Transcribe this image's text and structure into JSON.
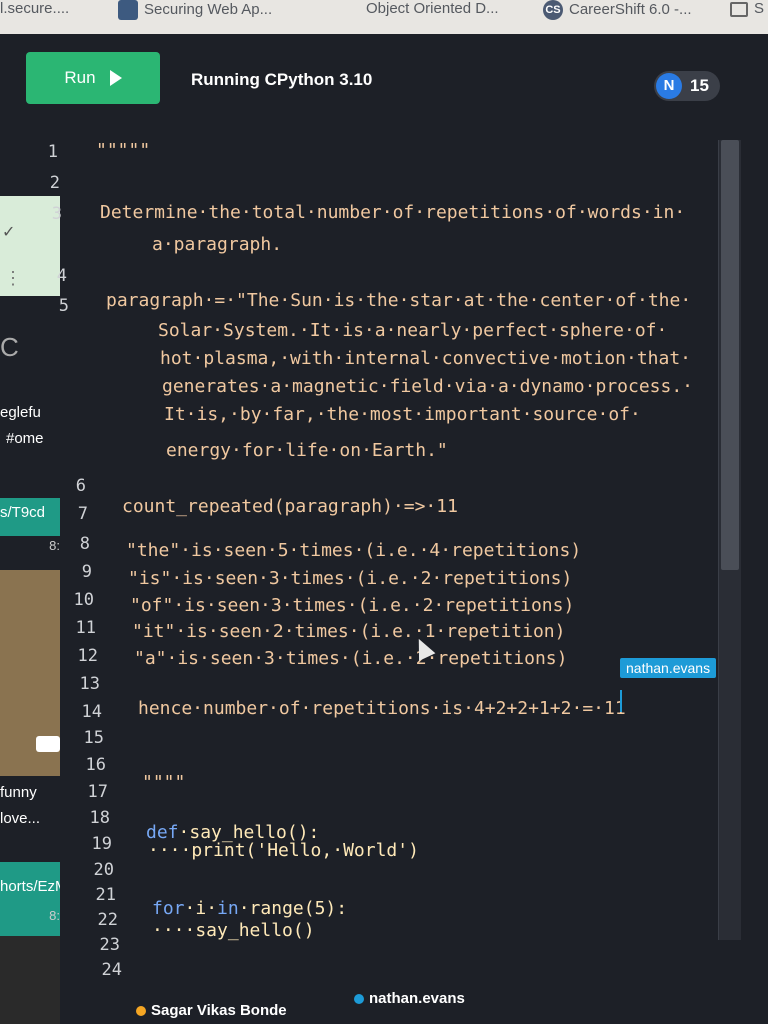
{
  "bookmarks": [
    {
      "label": "l.secure....",
      "icon": "lock-icon"
    },
    {
      "label": "Securing Web Ap...",
      "icon": "site-icon"
    },
    {
      "label": "Object Oriented D...",
      "icon": ""
    },
    {
      "label": "CareerShift 6.0 -...",
      "icon": "cs-icon"
    },
    {
      "label": "S",
      "icon": "folder-icon"
    }
  ],
  "left_panel": {
    "egleft": "eglefu",
    "home": "#ome",
    "path": "s/T9cd",
    "n8": "8:",
    "funny": "funny",
    "love": "love...",
    "shorts": "horts/EzMr",
    "n8b": "8:",
    "c": "C",
    "chevron": "✓"
  },
  "toolbar": {
    "run_label": "Run",
    "runtime_status": "Running CPython 3.10",
    "user_initial": "N",
    "user_count": "15"
  },
  "editor": {
    "line_numbers": [
      "1",
      "2",
      "3",
      "4",
      "5",
      "6",
      "7",
      "8",
      "9",
      "10",
      "11",
      "12",
      "13",
      "14",
      "15",
      "16",
      "17",
      "18",
      "19",
      "20",
      "21",
      "22",
      "23",
      "24"
    ],
    "lines": {
      "l1": "\"\"\"\"\"",
      "l3a": "Determine·the·total·number·of·repetitions·of·words·in·",
      "l3b": "a·paragraph.",
      "l5a": "paragraph·=·\"The·Sun·is·the·star·at·the·center·of·the·",
      "l5b": "Solar·System.·It·is·a·nearly·perfect·sphere·of·",
      "l5c": "hot·plasma,·with·internal·convective·motion·that·",
      "l5d": "generates·a·magnetic·field·via·a·dynamo·process.·",
      "l5e": "It·is,·by·far,·the·most·important·source·of·",
      "l5f": "energy·for·life·on·Earth.\"",
      "l7": "count_repeated(paragraph)·=>·11",
      "l9": "\"the\"·is·seen·5·times·(i.e.·4·repetitions)",
      "l10": "\"is\"·is·seen·3·times·(i.e.·2·repetitions)",
      "l11": "\"of\"·is·seen·3·times·(i.e.·2·repetitions)",
      "l12": "\"it\"·is·seen·2·times·(i.e.·1·repetition)",
      "l13": "\"a\"·is·seen·3·times·(i.e.·2·repetitions)",
      "l15": "hence·number·of·repetitions·is·4+2+2+1+2·=·11",
      "l17": "\"\"\"\"",
      "l19_kw": "def",
      "l19_rest": "·say_hello():",
      "l20": "····print('Hello,·World')",
      "l22_for": "for",
      "l22_i": "·i·",
      "l22_in": "in",
      "l22_rest": "·range(5):",
      "l23": "····say_hello()"
    },
    "cursor_user": "nathan.evans"
  },
  "footer": {
    "collaborators": [
      {
        "name": "Sagar Vikas Bonde",
        "color": "#f5a623"
      },
      {
        "name": "nathan.evans",
        "color": "#1d9bd7"
      }
    ]
  }
}
